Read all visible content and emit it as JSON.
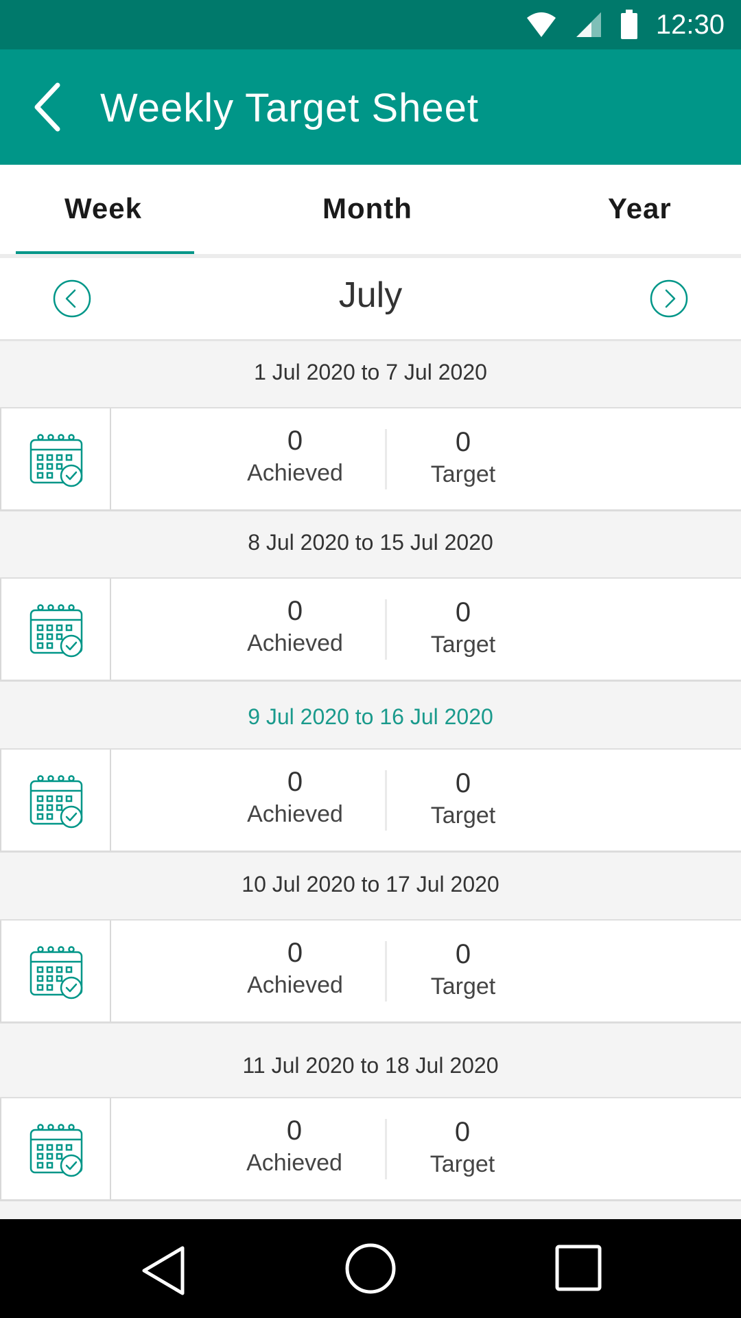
{
  "status_bar": {
    "time": "12:30"
  },
  "app_bar": {
    "title": "Weekly Target Sheet",
    "back_icon": "chevron-left-icon"
  },
  "tabs": [
    {
      "label": "Week",
      "selected": true
    },
    {
      "label": "Month",
      "selected": false
    },
    {
      "label": "Year",
      "selected": false
    }
  ],
  "month_nav": {
    "title": "July",
    "prev_icon": "circle-chevron-left-icon",
    "next_icon": "circle-chevron-right-icon"
  },
  "weeks": [
    {
      "range": "1 Jul 2020 to 7 Jul 2020",
      "achieved": "0",
      "achieved_label": "Achieved",
      "target": "0",
      "target_label": "Target",
      "highlighted": false
    },
    {
      "range": "8 Jul 2020 to 15 Jul 2020",
      "achieved": "0",
      "achieved_label": "Achieved",
      "target": "0",
      "target_label": "Target",
      "highlighted": false
    },
    {
      "range": "9 Jul 2020 to 16 Jul 2020",
      "achieved": "0",
      "achieved_label": "Achieved",
      "target": "0",
      "target_label": "Target",
      "highlighted": true
    },
    {
      "range": "10 Jul 2020 to 17 Jul 2020",
      "achieved": "0",
      "achieved_label": "Achieved",
      "target": "0",
      "target_label": "Target",
      "highlighted": false
    },
    {
      "range": "11 Jul 2020 to 18 Jul 2020",
      "achieved": "0",
      "achieved_label": "Achieved",
      "target": "0",
      "target_label": "Target",
      "highlighted": false
    }
  ],
  "colors": {
    "primary": "#009688",
    "primary_dark": "#00796b",
    "highlight_text": "#1a9a8c"
  }
}
